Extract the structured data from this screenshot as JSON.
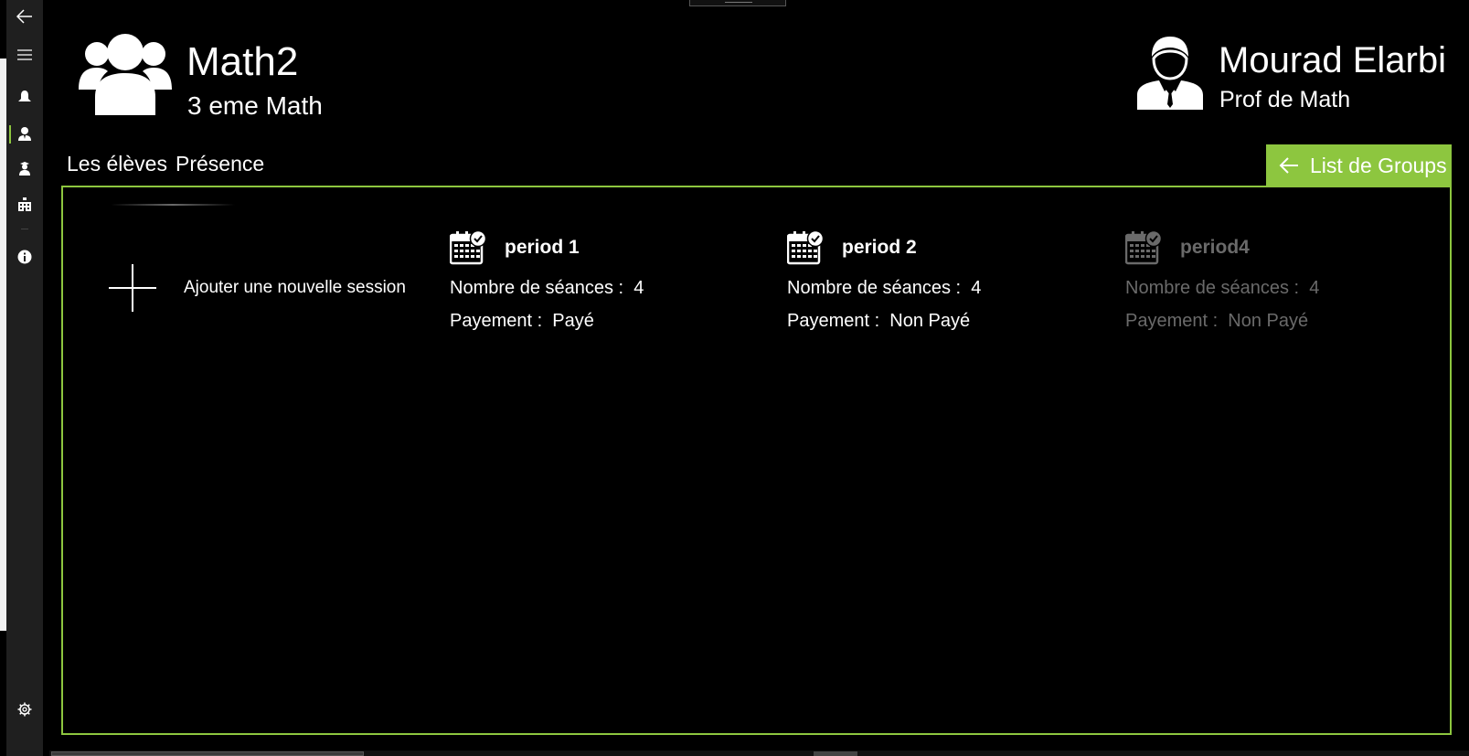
{
  "header": {
    "group_name": "Math2",
    "group_level": "3 eme Math",
    "user_name": "Mourad Elarbi",
    "user_role": "Prof de  Math"
  },
  "sidebar": {
    "items": [
      {
        "icon": "back-arrow-icon"
      },
      {
        "icon": "hamburger-menu-icon"
      },
      {
        "icon": "bell-icon"
      },
      {
        "icon": "teacher-icon",
        "selected": true
      },
      {
        "icon": "student-icon"
      },
      {
        "icon": "school-building-icon"
      },
      {
        "icon": "info-icon"
      },
      {
        "icon": "settings-icon"
      }
    ]
  },
  "tabs": [
    {
      "label": "Les élèves"
    },
    {
      "label": "Présence"
    }
  ],
  "back_button": {
    "label": "List de Groups"
  },
  "add_session": {
    "label": "Ajouter une nouvelle session"
  },
  "periods": [
    {
      "name": "period 1",
      "sessions_label": "Nombre de séances :",
      "sessions": "4",
      "payment_label": "Payement :",
      "payment": "Payé",
      "dimmed": false
    },
    {
      "name": "period 2",
      "sessions_label": "Nombre de séances :",
      "sessions": "4",
      "payment_label": "Payement :",
      "payment": "Non Payé",
      "dimmed": false
    },
    {
      "name": "period4",
      "sessions_label": "Nombre de séances :",
      "sessions": "4",
      "payment_label": "Payement :",
      "payment": "Non Payé",
      "dimmed": true
    }
  ],
  "colors": {
    "accent": "#8dc63f",
    "background": "#000000",
    "sidebar": "#1f1f1f",
    "dimmed_text": "#6a6a6a"
  }
}
